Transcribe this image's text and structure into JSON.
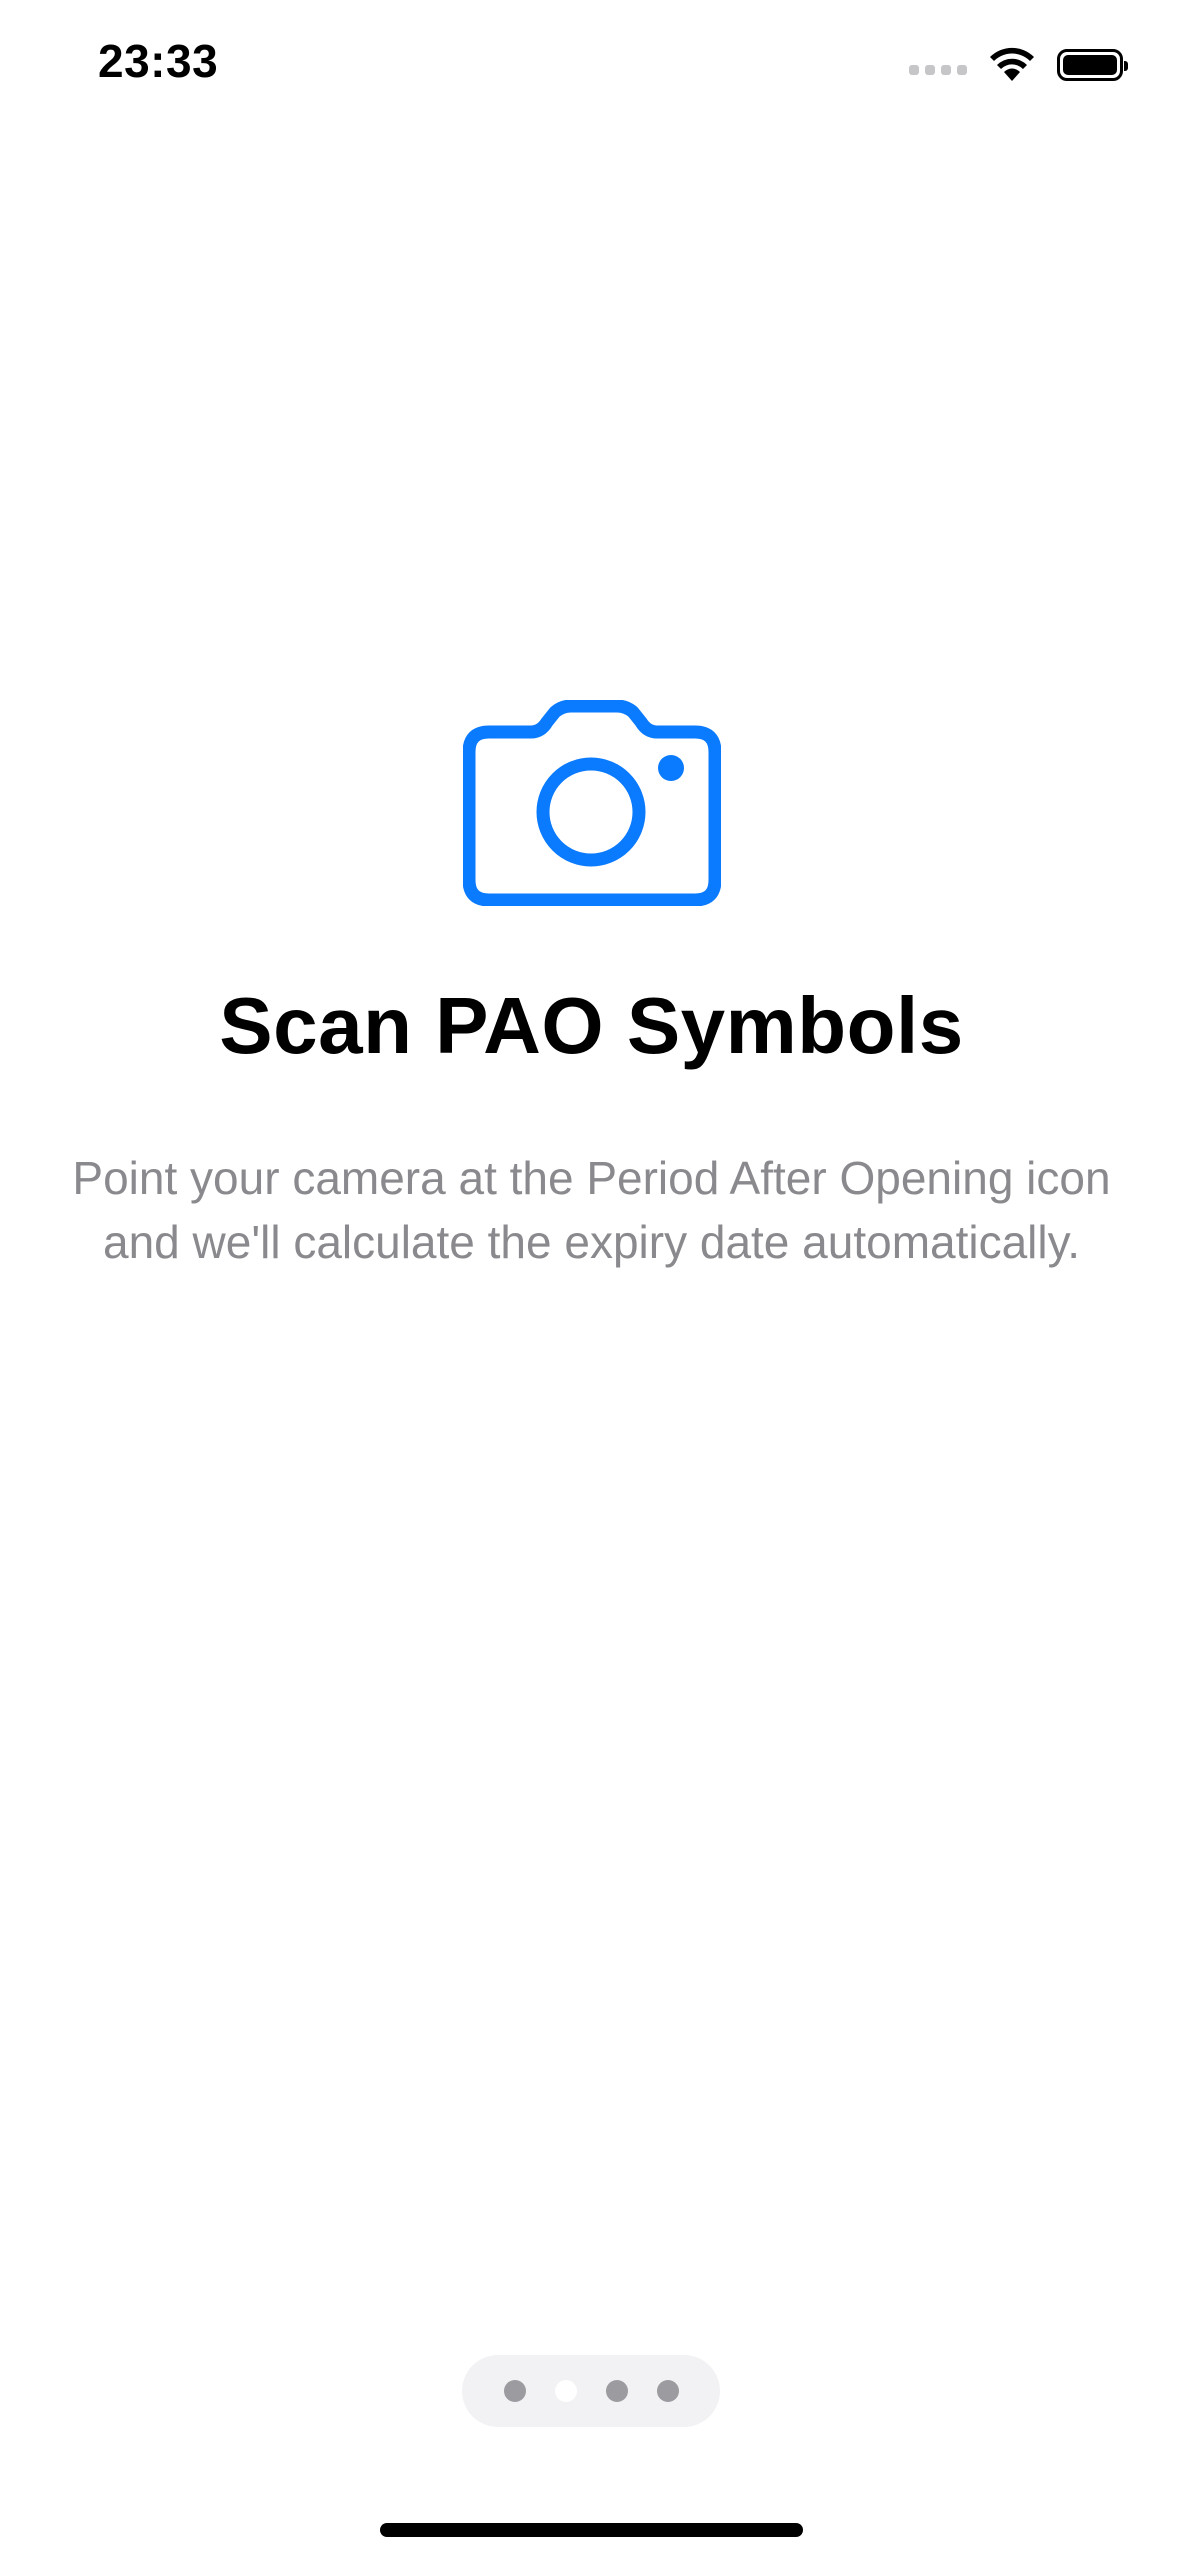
{
  "status_bar": {
    "time": "23:33",
    "icons": [
      "signal-icon",
      "wifi-icon",
      "battery-icon"
    ]
  },
  "onboarding": {
    "icon": "camera-icon",
    "accent_color": "#0a7aff",
    "title": "Scan PAO Symbols",
    "description": "Point your camera at the Period After Opening icon and we'll calculate the expiry date automatically."
  },
  "page_indicator": {
    "total_pages": 4,
    "current_page": 2
  }
}
